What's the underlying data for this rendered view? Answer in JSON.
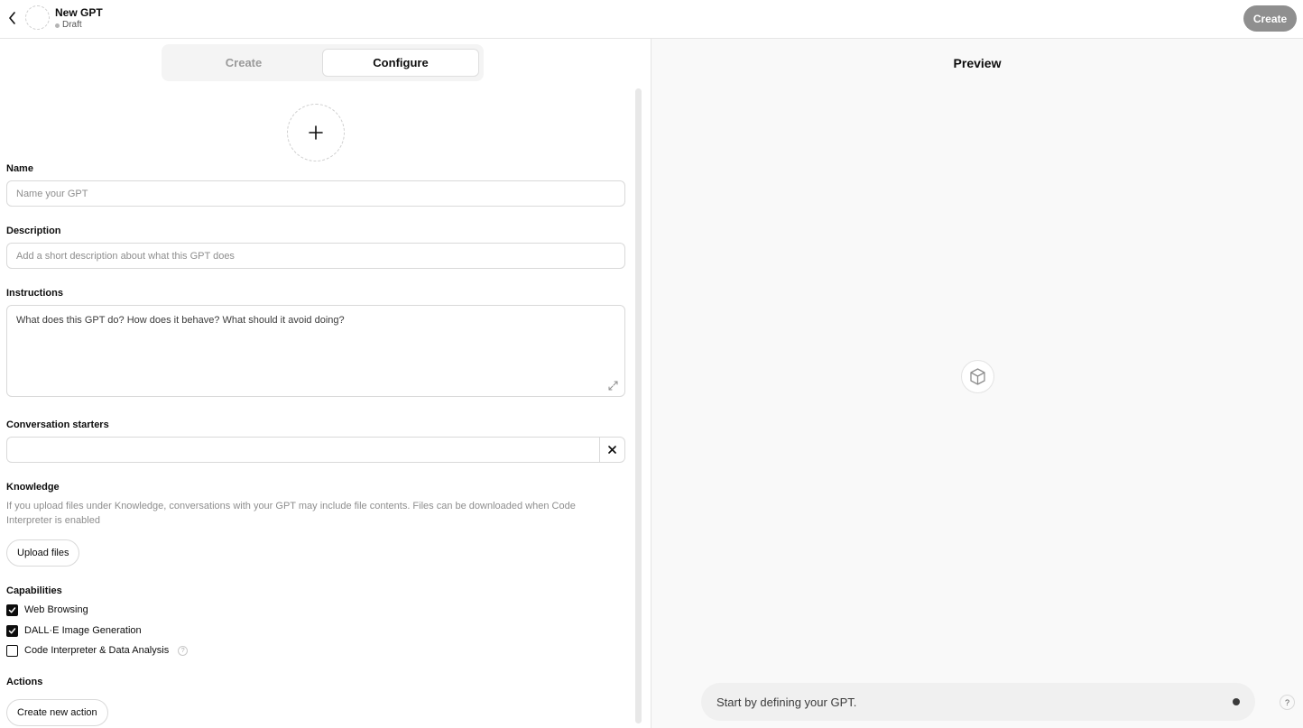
{
  "header": {
    "title": "New GPT",
    "status": "Draft",
    "create_button": "Create",
    "back_icon": "chevron-left-icon"
  },
  "tabs": [
    {
      "label": "Create",
      "active": false
    },
    {
      "label": "Configure",
      "active": true
    }
  ],
  "form": {
    "avatar_icon": "plus-icon",
    "name": {
      "label": "Name",
      "placeholder": "Name your GPT",
      "value": ""
    },
    "description": {
      "label": "Description",
      "placeholder": "Add a short description about what this GPT does",
      "value": ""
    },
    "instructions": {
      "label": "Instructions",
      "placeholder": "What does this GPT do? How does it behave? What should it avoid doing?",
      "value": ""
    },
    "conversation_starters": {
      "label": "Conversation starters",
      "value": ""
    },
    "knowledge": {
      "label": "Knowledge",
      "help": "If you upload files under Knowledge, conversations with your GPT may include file contents. Files can be downloaded when Code Interpreter is enabled",
      "upload_button": "Upload files"
    },
    "capabilities": {
      "label": "Capabilities",
      "items": [
        {
          "label": "Web Browsing",
          "checked": true
        },
        {
          "label": "DALL·E Image Generation",
          "checked": true
        },
        {
          "label": "Code Interpreter & Data Analysis",
          "checked": false,
          "info": "?"
        }
      ]
    },
    "actions": {
      "label": "Actions",
      "button": "Create new action"
    }
  },
  "preview": {
    "title": "Preview",
    "logo_icon": "cube-icon",
    "chat_placeholder": "Start by defining your GPT.",
    "help_label": "?"
  },
  "colors": {
    "accent_dark": "#0d0d0d",
    "create_button_bg": "#8f8f8f",
    "preview_bg": "#f9f9f9"
  }
}
